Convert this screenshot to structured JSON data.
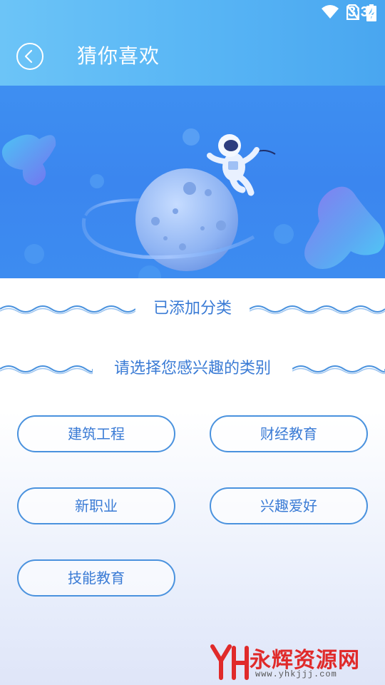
{
  "status_bar": {
    "time": "3:32",
    "icons": [
      "wifi-icon",
      "no-sim-icon",
      "battery-charging-icon"
    ]
  },
  "header": {
    "back_icon": "back-circle-icon",
    "title": "猜你喜欢"
  },
  "banner": {
    "illustration": "astronaut-and-planet"
  },
  "sections": {
    "added": "已添加分类",
    "choose": "请选择您感兴趣的类别"
  },
  "categories": [
    {
      "label": "建筑工程"
    },
    {
      "label": "财经教育"
    },
    {
      "label": "新职业"
    },
    {
      "label": "兴趣爱好"
    },
    {
      "label": "技能教育"
    }
  ],
  "watermark": {
    "logo": "YH",
    "name": "永辉资源网",
    "url": "www.yhkjjj.com"
  },
  "colors": {
    "header_gradient_start": "#6cc4f7",
    "header_gradient_end": "#49a6f0",
    "banner_bg": "#3e8ff1",
    "accent": "#3a7bd5",
    "button_border": "#4a92de",
    "watermark_red": "#e02a2a"
  }
}
